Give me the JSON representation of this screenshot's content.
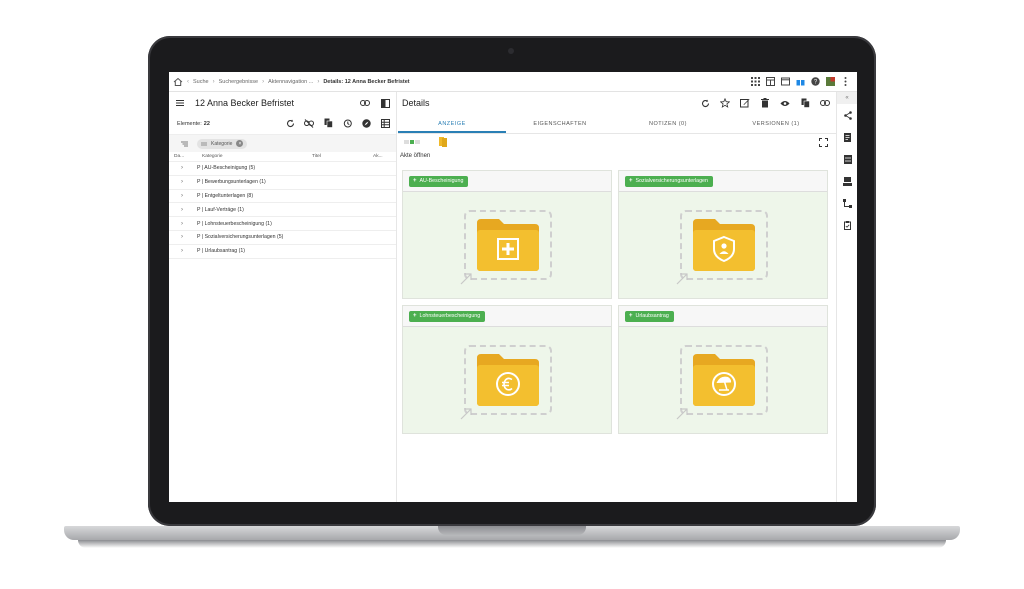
{
  "breadcrumb": [
    "Suche",
    "Suchergebnisse",
    "Aktennavigation ...",
    "Details: 12 Anna Becker Befristet"
  ],
  "left": {
    "title": "12 Anna Becker Befristet",
    "elements_label": "Elemente:",
    "elements_count": "22",
    "filter_chip": "Kategorie",
    "columns": [
      "Da...",
      "Kategorie",
      "Titel",
      "Ak..."
    ],
    "rows": [
      "P | AU-Bescheinigung (5)",
      "P | Bewerbungsunterlagen (1)",
      "P | Entgeltunterlagen (8)",
      "P | Lauf-Verträge (1)",
      "P | Lohnsteuerbescheinigung (1)",
      "P | Sozialversicherungsunterlagen (5)",
      "P | Urlaubsantrag (1)"
    ]
  },
  "right": {
    "title": "Details",
    "tabs": [
      "ANZEIGE",
      "EIGENSCHAFTEN",
      "NOTIZEN (0)",
      "VERSIONEN (1)"
    ],
    "section_label": "Akte öffnen",
    "cards": [
      {
        "label": "AU-Bescheinigung",
        "icon": "medical-cross-icon"
      },
      {
        "label": "Sozialversicherungsunterlagen",
        "icon": "shield-person-icon"
      },
      {
        "label": "Lohnsteuerbescheinigung",
        "icon": "euro-icon"
      },
      {
        "label": "Urlaubsantrag",
        "icon": "beach-umbrella-icon"
      }
    ]
  },
  "colors": {
    "accent": "#2a7fb5",
    "add_button": "#4caf50",
    "folder": "#f0b92a",
    "card_bg": "#eef6ea"
  }
}
